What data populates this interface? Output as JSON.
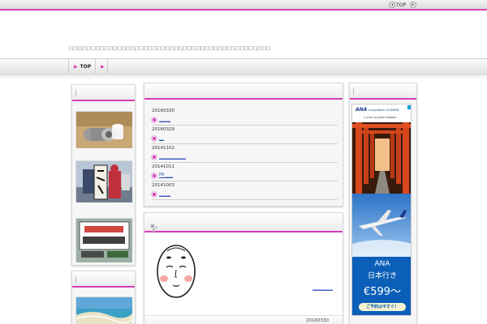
{
  "topbar": {
    "top_label": "TOP",
    "prev_icon": "triangle-left-icon",
    "next_icon": "triangle-right-icon"
  },
  "header": {
    "tagline": "□□□□□□□□□□□□□□□□□□□□□□□□□□□□□□□□□□□□□□□□□□□□□□"
  },
  "nav": {
    "items": [
      {
        "label": "TOP"
      },
      {
        "label": ""
      }
    ]
  },
  "entries": [
    {
      "date": "20160330",
      "title": "_____"
    },
    {
      "date": "20160329",
      "title": "__"
    },
    {
      "date": "20141102",
      "title": "____________"
    },
    {
      "date": "20141011",
      "title": "FA____"
    },
    {
      "date": "20141003",
      "title": "_____"
    }
  ],
  "post": {
    "link_text": "_________",
    "date": "20160330"
  },
  "ad": {
    "brand": "ANA",
    "inspiration": "Inspiration of JAPAN",
    "alliance": "A STAR ALLIANCE MEMBER",
    "headline_1": "ANA",
    "headline_2": "日本行き",
    "price": "€599～",
    "cta": "ご予約は今すぐ！",
    "brand_color": "#1a3c8c"
  },
  "colors": {
    "accent": "#d63fb8"
  }
}
